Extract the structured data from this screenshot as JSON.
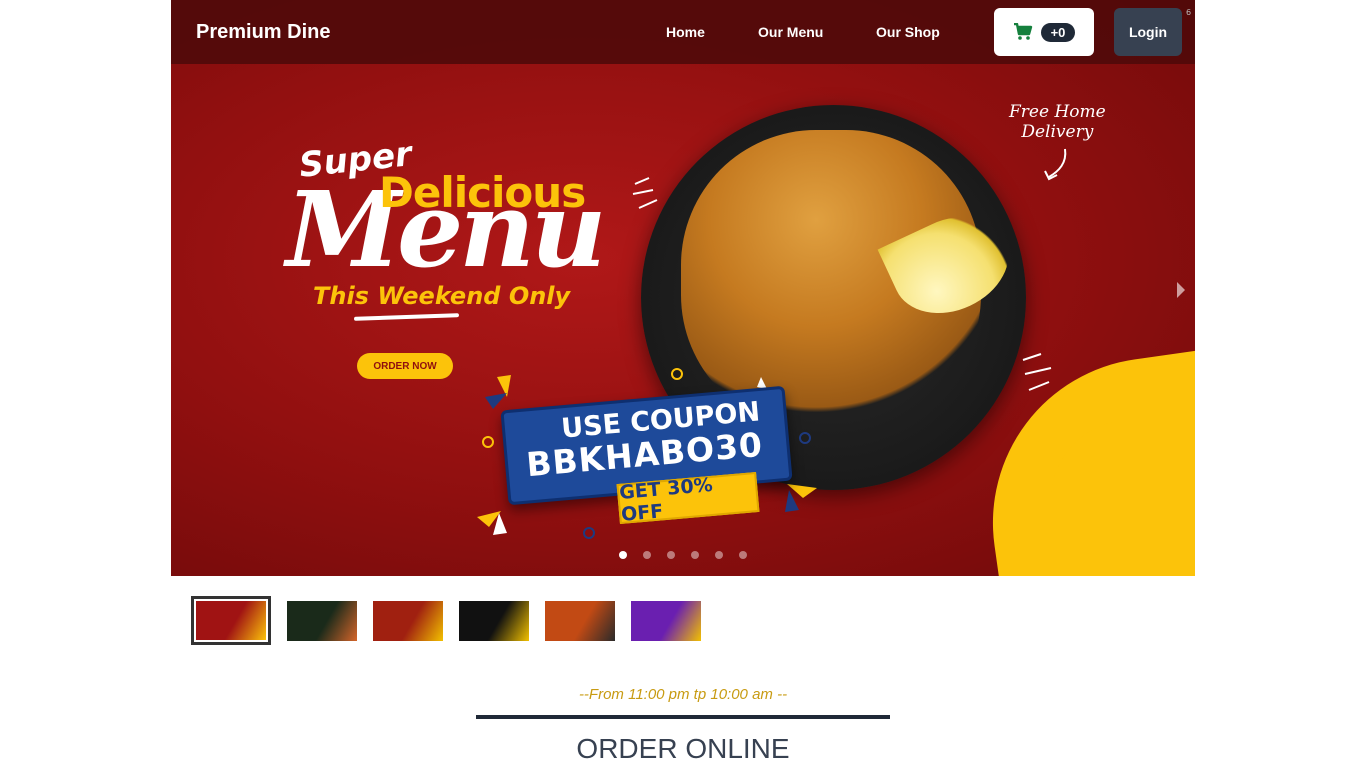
{
  "navbar": {
    "brand": "Premium Dine",
    "links": [
      {
        "label": "Home"
      },
      {
        "label": "Our Menu"
      },
      {
        "label": "Our Shop"
      }
    ],
    "cart_count": "+0",
    "login_label": "Login",
    "corner_mark": "6"
  },
  "hero": {
    "super": "Super",
    "delicious": "Delicious",
    "menu": "Menu",
    "weekend": "This Weekend Only",
    "order_now": "ORDER NOW",
    "free_delivery_line1": "Free Home",
    "free_delivery_line2": "Delivery",
    "coupon_line1": "USE COUPON",
    "coupon_code": "BBKHABO30",
    "coupon_off": "GET 30% OFF",
    "slide_count": 6,
    "active_slide": 1
  },
  "thumbnails": [
    {
      "name": "slide-1",
      "color": "#a01313",
      "accent": "#fcc30a"
    },
    {
      "name": "slide-2",
      "color": "#1a2a1a",
      "accent": "#d5652a"
    },
    {
      "name": "slide-3",
      "color": "#a02010",
      "accent": "#f2c100"
    },
    {
      "name": "slide-4",
      "color": "#111111",
      "accent": "#f2c100"
    },
    {
      "name": "slide-5",
      "color": "#c24a14",
      "accent": "#2a2a2a"
    },
    {
      "name": "slide-6",
      "color": "#6a1fb0",
      "accent": "#f2c100"
    }
  ],
  "section": {
    "hours": "--From 11:00 pm tp 10:00 am --",
    "heading": "ORDER ONLINE"
  },
  "colors": {
    "brand_red": "#8f0f0f",
    "accent_yellow": "#fcc30a",
    "dark": "#1f2937",
    "gold_text": "#c89b12"
  },
  "icons": {
    "cart": "cart-icon",
    "next": "chevron-right-icon"
  }
}
